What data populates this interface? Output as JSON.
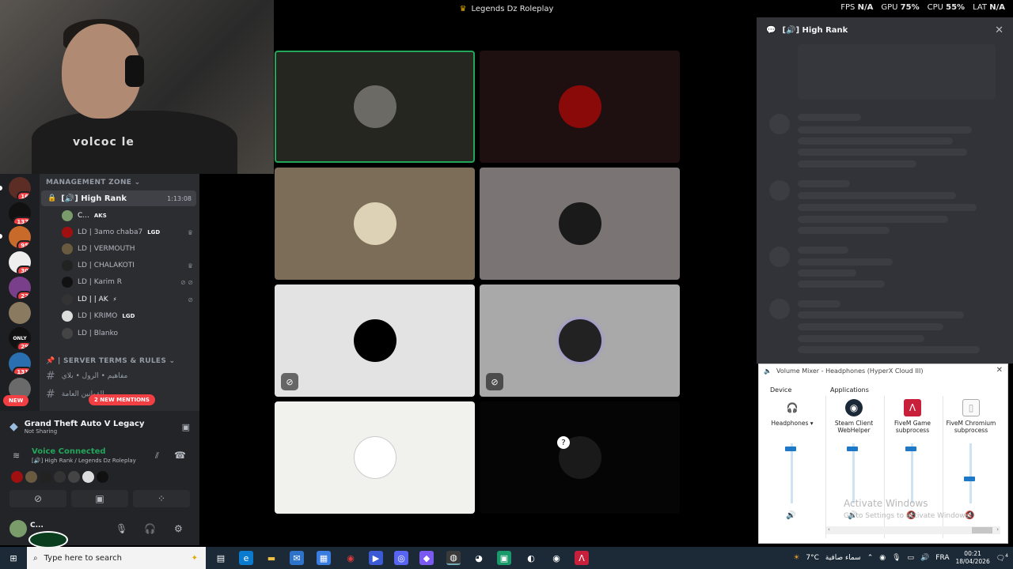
{
  "window": {
    "title": "Legends Dz Roleplay"
  },
  "overlay": {
    "fps_label": "FPS",
    "fps_value": "N/A",
    "gpu_label": "GPU",
    "gpu_value": "75%",
    "cpu_label": "CPU",
    "cpu_value": "55%",
    "lat_label": "LAT",
    "lat_value": "N/A"
  },
  "webcam": {
    "shirt_text": "volcoc le"
  },
  "servers": [
    {
      "badge": "16"
    },
    {
      "badge": "137"
    },
    {
      "badge": "95"
    },
    {
      "badge": "30"
    },
    {
      "badge": "22"
    },
    {
      "badge": ""
    },
    {
      "badge": "29",
      "label": "ONLY"
    },
    {
      "badge": "131"
    },
    {
      "badge": ""
    }
  ],
  "channels": {
    "category1": "MANAGEMENT ZONE",
    "voice_channel": {
      "name": "[🔊] High Rank",
      "time": "1:13:08"
    },
    "members": [
      {
        "name": "C...",
        "tag": "AKS"
      },
      {
        "name": "LD | 3amo chaba7",
        "tag": "LGD"
      },
      {
        "name": "LD | VERMOUTH",
        "tag": ""
      },
      {
        "name": "LD | CHALAKOTI",
        "tag": ""
      },
      {
        "name": "LD | Karim R",
        "tag": ""
      },
      {
        "name": "LD | | AK",
        "tag": "⚡"
      },
      {
        "name": "LD | KRIMO",
        "tag": "LGD"
      },
      {
        "name": "LD | Blanko",
        "tag": ""
      }
    ],
    "category2": "SERVER TERMS & RULES",
    "text_channels": [
      "مفاهيم • الرول • بلاي",
      "القوانين العامة"
    ],
    "new_label": "NEW",
    "mentions_label": "2 NEW MENTIONS"
  },
  "activity": {
    "game": "Grand Theft Auto V Legacy",
    "status": "Not Sharing"
  },
  "voice": {
    "title": "Voice Connected",
    "subtitle": "[🔊] High Rank / Legends Dz Roleplay"
  },
  "user": {
    "name": "C..."
  },
  "chat": {
    "title": "[🔊] High Rank"
  },
  "mixer": {
    "title": "Volume Mixer - Headphones (HyperX Cloud III)",
    "device_label": "Device",
    "apps_label": "Applications",
    "device": "Headphones",
    "apps": [
      "Steam Client WebHelper",
      "FiveM Game subprocess",
      "FiveM Chromium subprocess"
    ],
    "levels": [
      0.95,
      0.95,
      0.95,
      0.45
    ]
  },
  "watermark": {
    "line1": "Activate Windows",
    "line2": "Go to Settings to activate Windows."
  },
  "taskbar": {
    "search_placeholder": "Type here to search",
    "weather": "7°C",
    "weather_desc": "سماء صافية",
    "lang": "FRA",
    "time": "00:21",
    "date": "18/04/2026",
    "notif": "4"
  },
  "colors": {
    "speaking": "#23a55a",
    "accent": "#5865f2",
    "danger": "#f23f43"
  }
}
